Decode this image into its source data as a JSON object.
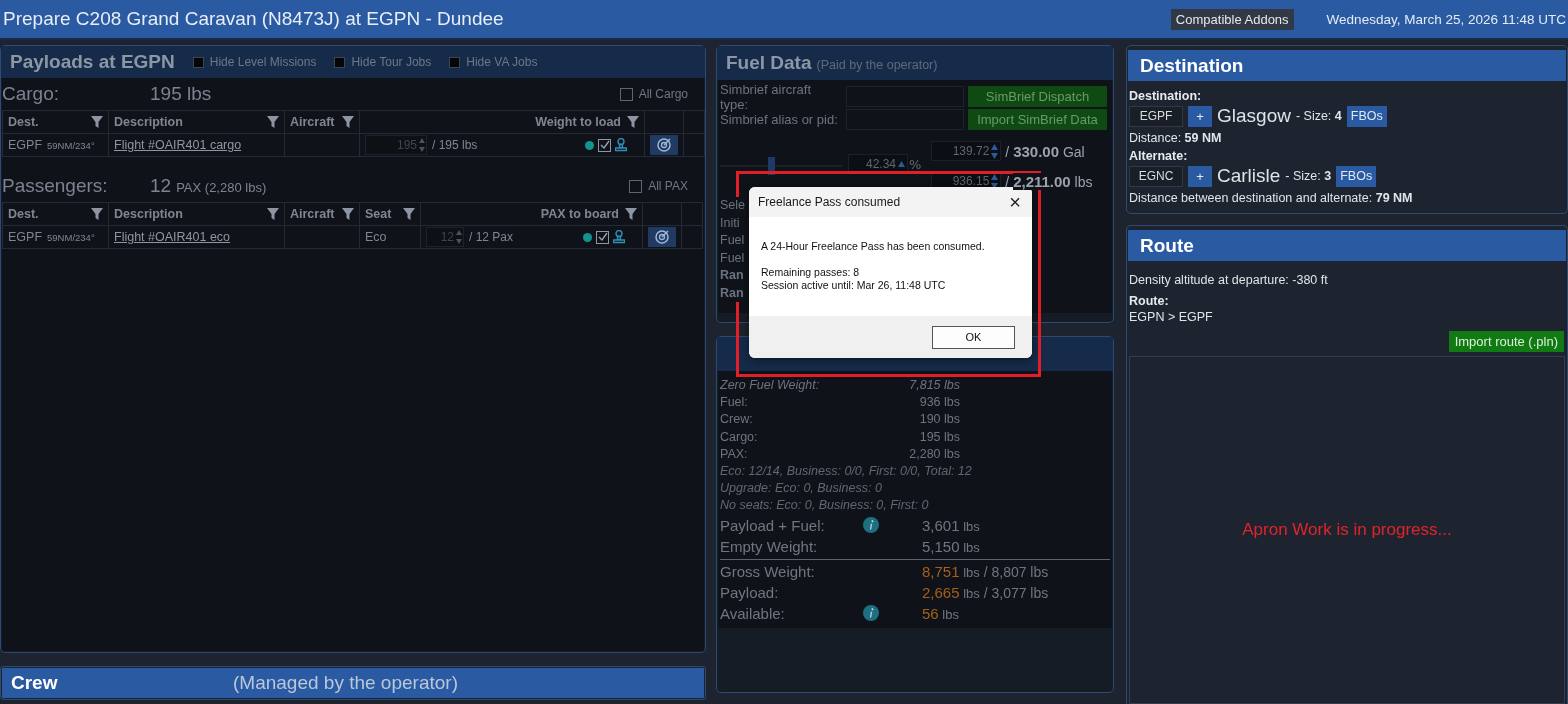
{
  "window": {
    "title": "Prepare C208 Grand Caravan (N8473J) at EGPN - Dundee",
    "addons_button": "Compatible Addons",
    "datetime": "Wednesday, March 25, 2026 11:48 UTC"
  },
  "payloads": {
    "title": "Payloads at EGPN",
    "filters": [
      {
        "label": "Hide Level Missions",
        "checked": false
      },
      {
        "label": "Hide Tour Jobs",
        "checked": false
      },
      {
        "label": "Hide VA Jobs",
        "checked": false
      }
    ],
    "cargo": {
      "label": "Cargo:",
      "total": "195 lbs",
      "all_label": "All Cargo",
      "all_checked": false,
      "columns": [
        {
          "label": "Dest.",
          "kind": "dest"
        },
        {
          "label": "Description",
          "kind": "desc"
        },
        {
          "label": "Aircraft",
          "kind": "aircraft"
        },
        {
          "label": "Weight to load",
          "kind": "amount"
        }
      ],
      "rows": [
        {
          "dest": "EGPF",
          "dest_detail": "59NM/234°",
          "description": "Flight #OAIR401 cargo",
          "aircraft": "",
          "amount": "195",
          "amount_total": "/ 195 lbs",
          "loaded": true
        }
      ]
    },
    "passengers": {
      "label": "Passengers:",
      "total": "12",
      "total_sub": "PAX (2,280 lbs)",
      "all_label": "All PAX",
      "all_checked": false,
      "columns": [
        {
          "label": "Dest.",
          "kind": "dest"
        },
        {
          "label": "Description",
          "kind": "desc"
        },
        {
          "label": "Aircraft",
          "kind": "aircraft"
        },
        {
          "label": "Seat",
          "kind": "seat"
        },
        {
          "label": "PAX to board",
          "kind": "amount"
        }
      ],
      "rows": [
        {
          "dest": "EGPF",
          "dest_detail": "59NM/234°",
          "description": "Flight #OAIR401 eco",
          "aircraft": "",
          "seat": "Eco",
          "amount": "12",
          "amount_total": "/ 12 Pax",
          "loaded": true
        }
      ]
    }
  },
  "crew": {
    "title": "Crew",
    "note": "(Managed by the operator)"
  },
  "fuel": {
    "title": "Fuel Data",
    "subtitle": "(Paid by the operator)",
    "simbrief": [
      {
        "label": "Simbrief aircraft type:",
        "button": "SimBrief Dispatch"
      },
      {
        "label": "Simbrief alias or pid:",
        "button": "Import SimBrief Data"
      }
    ],
    "level": 0.42,
    "percent": "42.34",
    "percent_unit": "%",
    "separator": "/",
    "gallons": "139.72",
    "gallons_max": "330.00",
    "gallons_unit": "Gal",
    "pounds": "936.15",
    "pounds_max": "2,211.00",
    "pounds_unit": "lbs",
    "hidden_lines": [
      {
        "text": "Sele",
        "kind": "label"
      },
      {
        "text": "Initi",
        "kind": "label"
      },
      {
        "text": "Fuel",
        "kind": "label"
      },
      {
        "text": "Fuel",
        "kind": "label"
      },
      {
        "text": "Ran",
        "kind": "heading"
      },
      {
        "text": "Ran",
        "kind": "heading"
      }
    ]
  },
  "weights": {
    "rows": [
      {
        "kind": "line",
        "label": "Zero Fuel Weight:",
        "value": "7,815 lbs",
        "italic": true
      },
      {
        "kind": "line",
        "label": "Fuel:",
        "value": "936 lbs",
        "italic": false
      },
      {
        "kind": "line",
        "label": "Crew:",
        "value": "190 lbs",
        "italic": false
      },
      {
        "kind": "line",
        "label": "Cargo:",
        "value": "195 lbs",
        "italic": false
      },
      {
        "kind": "line",
        "label": "PAX:",
        "value": "2,280 lbs",
        "italic": false
      },
      {
        "kind": "note",
        "label": "Eco: 12/14, Business: 0/0, First: 0/0, Total: 12"
      },
      {
        "kind": "note",
        "label": "Upgrade: Eco: 0, Business: 0"
      },
      {
        "kind": "note",
        "label": "No seats: Eco: 0, Business: 0, First: 0"
      },
      {
        "kind": "big",
        "label": "Payload + Fuel:",
        "info": true,
        "value": "3,601",
        "unit": "lbs",
        "limit": "",
        "highlight": false
      },
      {
        "kind": "big",
        "label": "Empty Weight:",
        "info": false,
        "value": "5,150",
        "unit": "lbs",
        "limit": "",
        "highlight": false
      },
      {
        "kind": "divider"
      },
      {
        "kind": "big",
        "label": "Gross Weight:",
        "info": false,
        "value": "8,751",
        "unit": "lbs",
        "limit": "/ 8,807 lbs",
        "highlight": true
      },
      {
        "kind": "big",
        "label": "Payload:",
        "info": false,
        "value": "2,665",
        "unit": "lbs",
        "limit": "/ 3,077 lbs",
        "highlight": true
      },
      {
        "kind": "big",
        "label": "Available:",
        "info": true,
        "value": "56",
        "unit": "lbs",
        "limit": "",
        "highlight": true
      }
    ]
  },
  "destination": {
    "title": "Destination",
    "airports": [
      {
        "label": "Destination:",
        "code": "EGPF",
        "add": "+",
        "name": "Glasgow",
        "size_label": "- Size:",
        "size": "4",
        "fbo": "FBOs",
        "distance": "Distance: **59 NM**"
      },
      {
        "label": "Alternate:",
        "code": "EGNC",
        "add": "+",
        "name": "Carlisle",
        "size_label": "- Size:",
        "size": "3",
        "fbo": "FBOs",
        "distance": "Distance between destination and alternate: **79 NM**"
      }
    ]
  },
  "route": {
    "title": "Route",
    "density": "Density altitude at departure: -380 ft",
    "route_label": "Route:",
    "route": "EGPN > EGPF",
    "import_button": "Import route (.pln)",
    "map_status": "Apron Work is in progress..."
  },
  "dialog": {
    "title": "Freelance Pass consumed",
    "close": "×",
    "paragraphs": [
      [
        "A 24-Hour Freelance Pass has been consumed."
      ],
      [
        "Remaining passes: 8",
        "Session active until: Mar 26, 11:48 UTC"
      ]
    ],
    "button": "OK",
    "highlighted": true
  }
}
